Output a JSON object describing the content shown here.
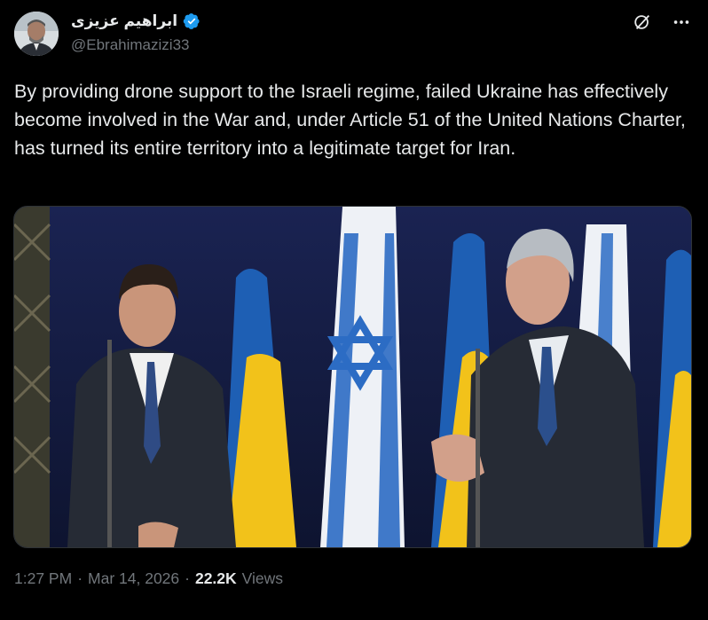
{
  "author": {
    "display_name": "ابراهیم عزیزی",
    "handle": "@Ebrahimazizi33",
    "verified": true,
    "verified_color": "#1d9bf0"
  },
  "tweet": {
    "text": "By providing drone support to the Israeli regime, failed Ukraine has effectively become involved in the War and, under Article 51 of the United Nations Charter, has turned its entire territory into a legitimate target for Iran."
  },
  "meta": {
    "time": "1:27 PM",
    "separator": "·",
    "date": "Mar 14, 2026",
    "views_count": "22.2K",
    "views_label": "Views"
  },
  "icons": {
    "grok": "grok-icon",
    "more": "more-icon",
    "verified": "verified-badge-icon"
  },
  "colors": {
    "background": "#000000",
    "text": "#e7e9ea",
    "secondary": "#71767b",
    "accent": "#1d9bf0"
  }
}
